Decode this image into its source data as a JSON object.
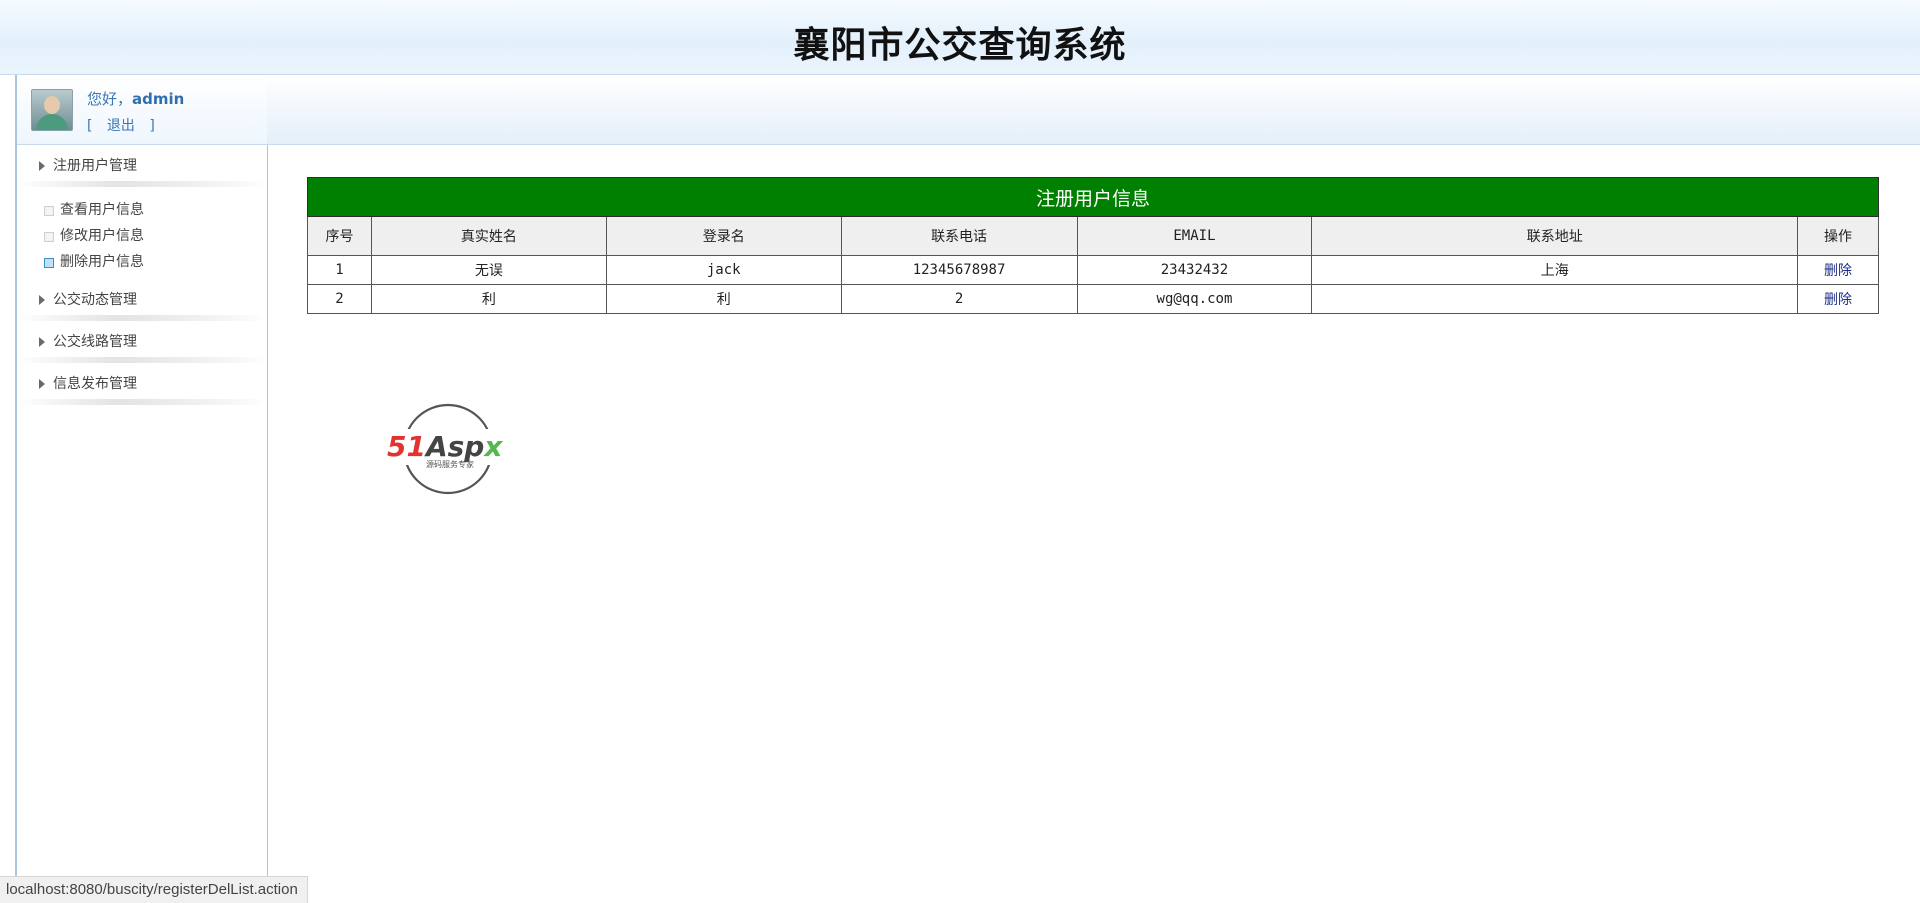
{
  "header": {
    "title": "襄阳市公交查询系统"
  },
  "user": {
    "greeting": "您好，",
    "name": "admin",
    "logout_open": "[",
    "logout_label": "退出",
    "logout_close": "]"
  },
  "sidebar": {
    "groups": [
      {
        "label": "注册用户管理",
        "items": [
          {
            "label": "查看用户信息"
          },
          {
            "label": "修改用户信息"
          },
          {
            "label": "删除用户信息"
          }
        ]
      },
      {
        "label": "公交动态管理"
      },
      {
        "label": "公交线路管理"
      },
      {
        "label": "信息发布管理"
      }
    ]
  },
  "table": {
    "caption": "注册用户信息",
    "columns": [
      "序号",
      "真实姓名",
      "登录名",
      "联系电话",
      "EMAIL",
      "联系地址",
      "操作"
    ],
    "rows": [
      {
        "id": "1",
        "real_name": "无误",
        "login": "jack",
        "phone": "12345678987",
        "email": "23432432",
        "address": "上海",
        "action": "删除"
      },
      {
        "id": "2",
        "real_name": "利",
        "login": "利",
        "phone": "2",
        "email": "wg@qq.com",
        "address": "",
        "action": "删除"
      }
    ]
  },
  "logo": {
    "brand_51": "51",
    "brand_a": "A",
    "brand_sp": "sp",
    "brand_x": "x",
    "tagline": "源码服务专家"
  },
  "colors": {
    "accent_green": "#008000",
    "link_blue": "#3a77b7",
    "logo_red": "#e23232",
    "logo_green": "#54b84a"
  },
  "statusbar": {
    "url": "localhost:8080/buscity/registerDelList.action"
  }
}
